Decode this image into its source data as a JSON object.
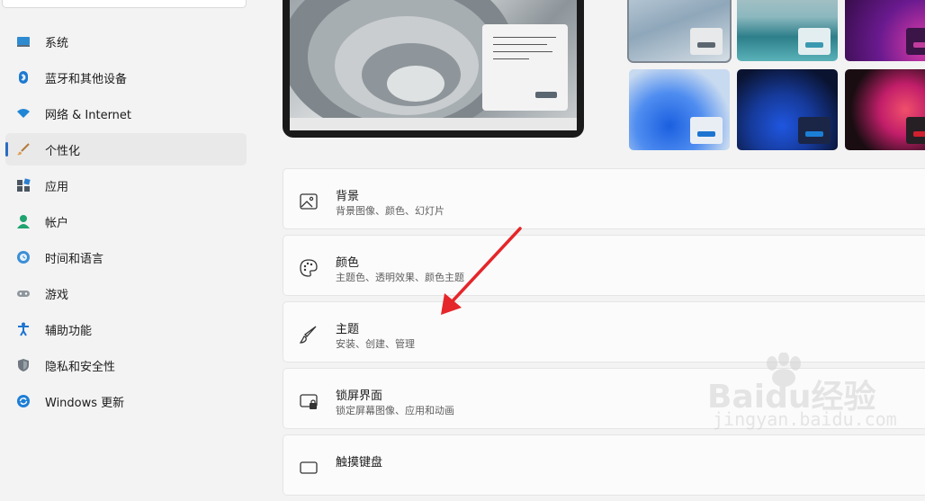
{
  "sidebar": {
    "items": [
      {
        "label": "系统",
        "icon": "display-icon"
      },
      {
        "label": "蓝牙和其他设备",
        "icon": "bluetooth-icon"
      },
      {
        "label": "网络 & Internet",
        "icon": "wifi-icon"
      },
      {
        "label": "个性化",
        "icon": "brush-icon",
        "selected": true
      },
      {
        "label": "应用",
        "icon": "apps-icon"
      },
      {
        "label": "帐户",
        "icon": "account-icon"
      },
      {
        "label": "时间和语言",
        "icon": "globe-clock-icon"
      },
      {
        "label": "游戏",
        "icon": "gamepad-icon"
      },
      {
        "label": "辅助功能",
        "icon": "accessibility-icon"
      },
      {
        "label": "隐私和安全性",
        "icon": "shield-icon"
      },
      {
        "label": "Windows 更新",
        "icon": "sync-icon"
      }
    ]
  },
  "settings": {
    "rows": [
      {
        "title": "背景",
        "subtitle": "背景图像、颜色、幻灯片",
        "icon": "image-icon"
      },
      {
        "title": "颜色",
        "subtitle": "主题色、透明效果、颜色主题",
        "icon": "palette-icon"
      },
      {
        "title": "主题",
        "subtitle": "安装、创建、管理",
        "icon": "brush-icon"
      },
      {
        "title": "锁屏界面",
        "subtitle": "锁定屏幕图像、应用和动画",
        "icon": "lock-screen-icon"
      },
      {
        "title": "触摸键盘",
        "subtitle": "",
        "icon": "keyboard-icon"
      }
    ]
  },
  "colors": {
    "accent": "#2b6cc4",
    "arrow": "#e5262a"
  },
  "watermark": {
    "brand": "Baidu经验",
    "domain": "jingyan.baidu.com"
  }
}
